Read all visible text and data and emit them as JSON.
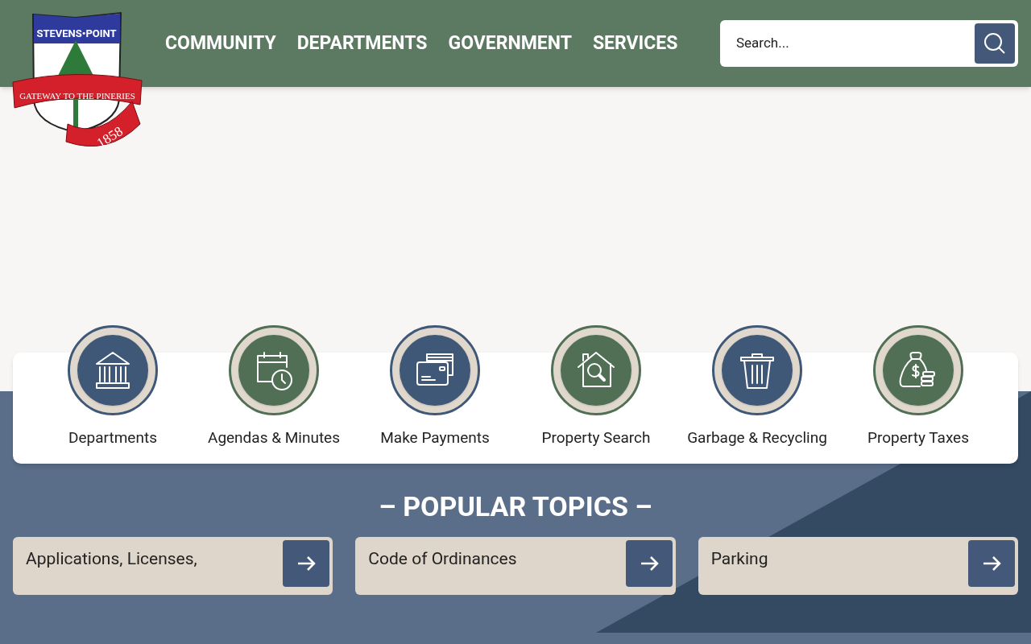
{
  "logo": {
    "top": "STEVENS•POINT",
    "ribbon": "GATEWAY TO THE PINERIES",
    "year": "1858"
  },
  "nav": [
    "COMMUNITY",
    "DEPARTMENTS",
    "GOVERNMENT",
    "SERVICES"
  ],
  "search": {
    "placeholder": "Search..."
  },
  "quick_links": [
    {
      "label": "Departments",
      "kind": "building",
      "color": "#3f5878"
    },
    {
      "label": "Agendas & Minutes",
      "kind": "calendar",
      "color": "#506f55"
    },
    {
      "label": "Make Payments",
      "kind": "cards",
      "color": "#3f5878"
    },
    {
      "label": "Property Search",
      "kind": "house",
      "color": "#506f55"
    },
    {
      "label": "Garbage & Recycling",
      "kind": "trash",
      "color": "#3f5878"
    },
    {
      "label": "Property Taxes",
      "kind": "moneybag",
      "color": "#506f55"
    }
  ],
  "popular_topics": {
    "title": "– POPULAR TOPICS –",
    "items": [
      "Applications, Licenses,",
      "Code of Ordinances",
      "Parking"
    ]
  }
}
